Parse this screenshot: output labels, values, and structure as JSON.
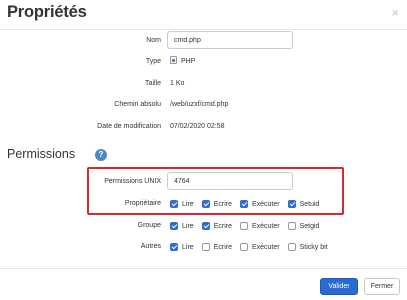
{
  "dialog": {
    "title": "Propriétés",
    "close_glyph": "×"
  },
  "properties": {
    "name_label": "Nom",
    "name_value": "cmd.php",
    "type_label": "Type",
    "type_value": "PHP",
    "type_icon": "php-file-icon",
    "size_label": "Taille",
    "size_value": "1 Ko",
    "path_label": "Chemin absolu",
    "path_value": "/web/uzxf/cmd.php",
    "modified_label": "Date de modification",
    "modified_value": "07/02/2020 02:58"
  },
  "permissions": {
    "section_title": "Permissions",
    "help_glyph": "?",
    "unix_label": "Permissions UNIX",
    "unix_value": "4764",
    "highlight_color": "#d9282f",
    "owner": {
      "label": "Propriétaire",
      "options": [
        {
          "label": "Lire",
          "checked": true
        },
        {
          "label": "Ecrire",
          "checked": true
        },
        {
          "label": "Exécuter",
          "checked": true
        },
        {
          "label": "Setuid",
          "checked": true
        }
      ]
    },
    "group": {
      "label": "Groupe",
      "options": [
        {
          "label": "Lire",
          "checked": true
        },
        {
          "label": "Ecrire",
          "checked": true
        },
        {
          "label": "Exécuter",
          "checked": false
        },
        {
          "label": "Setgid",
          "checked": false
        }
      ]
    },
    "others": {
      "label": "Autres",
      "options": [
        {
          "label": "Lire",
          "checked": true
        },
        {
          "label": "Ecrire",
          "checked": false
        },
        {
          "label": "Exécuter",
          "checked": false
        },
        {
          "label": "Sticky bit",
          "checked": false
        }
      ]
    }
  },
  "footer": {
    "validate_label": "Valider",
    "close_label": "Fermer",
    "primary_color": "#2a6bd1"
  }
}
